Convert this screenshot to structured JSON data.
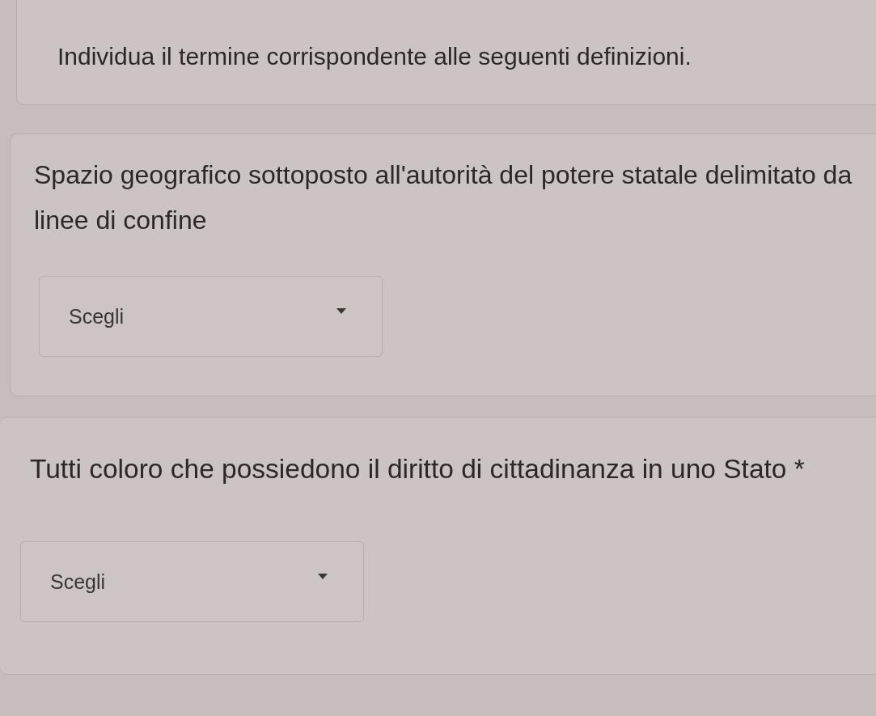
{
  "description": {
    "text": "Individua il termine corrispondente alle seguenti definizioni."
  },
  "questions": [
    {
      "text": "Spazio geografico sottoposto all'autorità del potere statale delimitato da linee di confine",
      "dropdown": {
        "placeholder": "Scegli"
      }
    },
    {
      "text": "Tutti coloro che possiedono il diritto di cittadinanza in uno Stato *",
      "dropdown": {
        "placeholder": "Scegli"
      }
    }
  ]
}
